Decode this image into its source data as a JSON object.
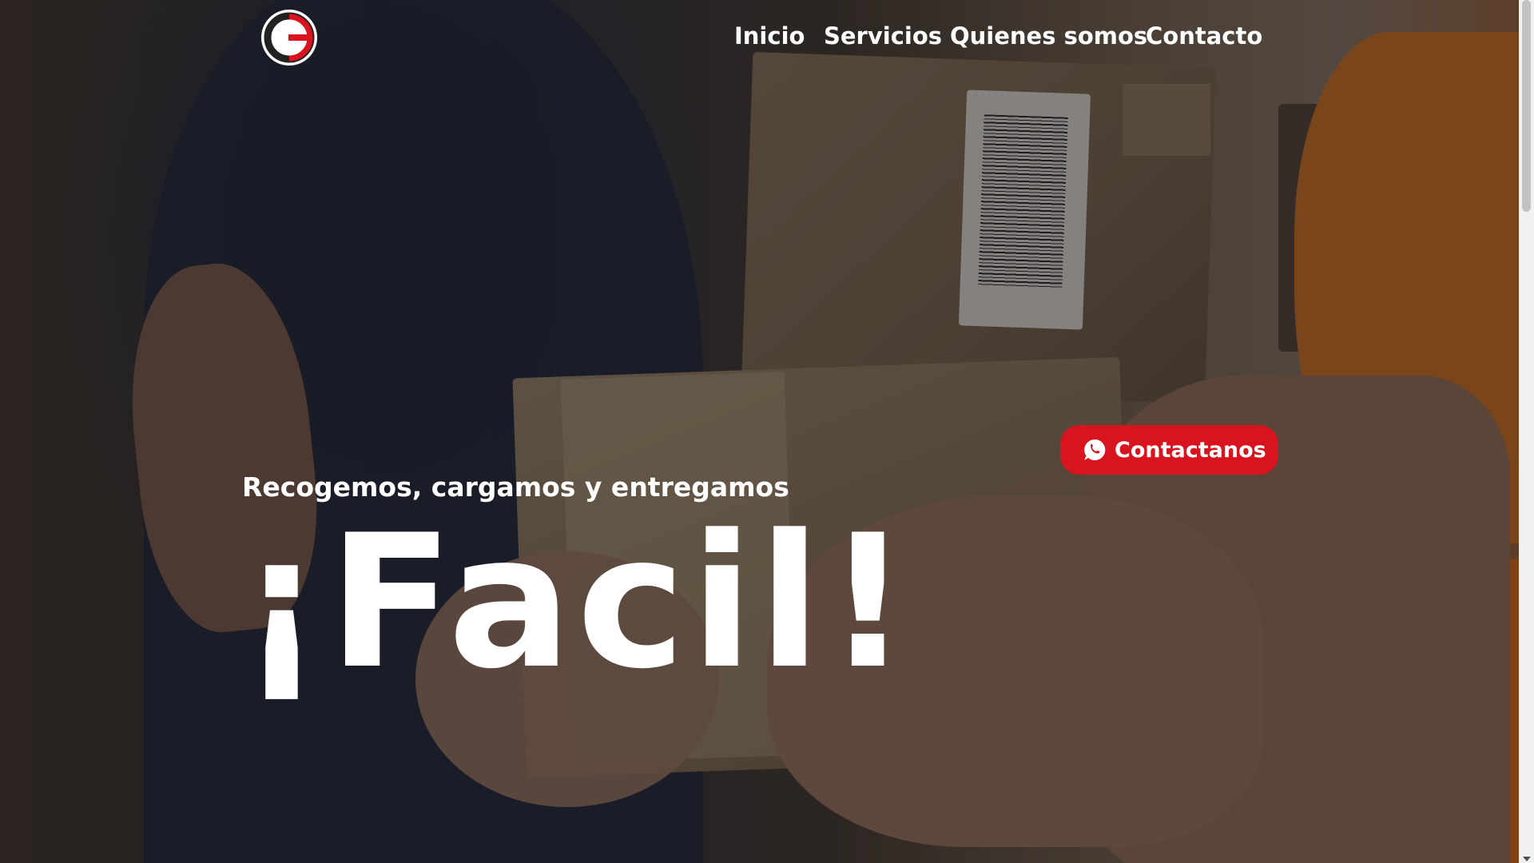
{
  "brand": {
    "logo_letter": "G",
    "colors": {
      "accent": "#d8141e",
      "logo_dark": "#222222",
      "logo_red": "#d8141e"
    }
  },
  "nav": {
    "items": [
      {
        "label": "Inicio"
      },
      {
        "label": "Servicios"
      },
      {
        "label": "Quienes somos"
      },
      {
        "label": "Contacto"
      }
    ]
  },
  "hero": {
    "subtitle": "Recogemos, cargamos y entregamos",
    "headline": "¡Facil!",
    "background_image": "delivery-person-handing-cardboard-boxes"
  },
  "cta": {
    "label": "Contactanos",
    "icon": "whatsapp-icon",
    "color": "#d8141e"
  }
}
